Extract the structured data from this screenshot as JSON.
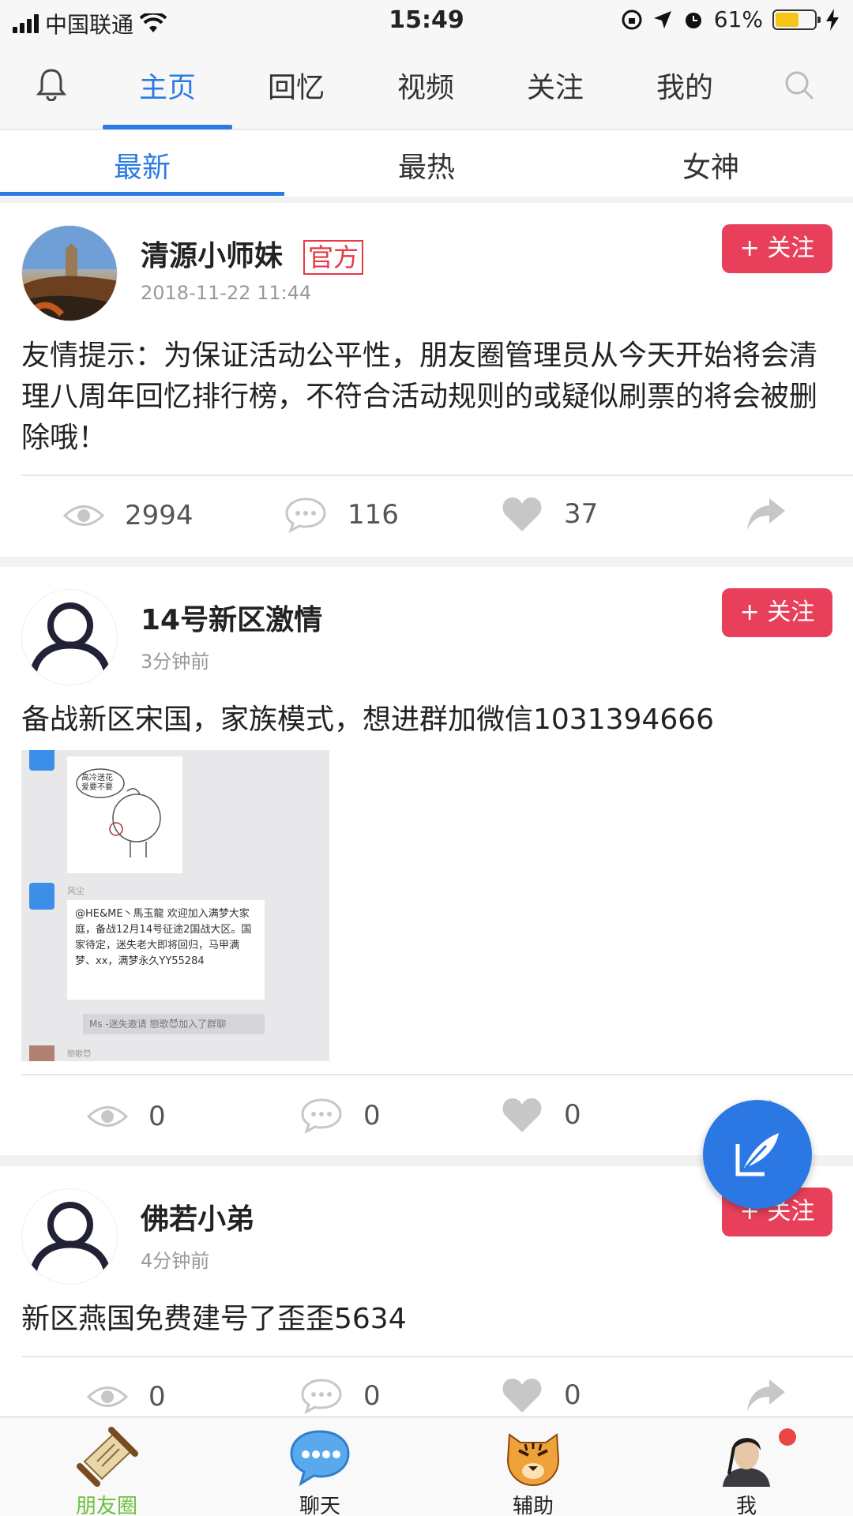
{
  "status_bar": {
    "carrier": "中国联通",
    "time": "15:49",
    "battery": "61%",
    "battery_level": 0.61
  },
  "top_nav": {
    "tabs": [
      {
        "label": "主页",
        "active": true
      },
      {
        "label": "回忆"
      },
      {
        "label": "视频"
      },
      {
        "label": "关注"
      },
      {
        "label": "我的"
      }
    ]
  },
  "sub_tabs": [
    {
      "label": "最新",
      "active": true
    },
    {
      "label": "最热"
    },
    {
      "label": "女神"
    }
  ],
  "colors": {
    "accent": "#2a7be4",
    "follow_button": "#e8405b",
    "official_badge": "#e63946",
    "bottom_active": "#6cbf3d"
  },
  "posts": [
    {
      "username": "清源小师妹",
      "badge": "官方",
      "timestamp": "2018-11-22 11:44",
      "follow_label": "+ 关注",
      "content": "友情提示：为保证活动公平性，朋友圈管理员从今天开始将会清理八周年回忆排行榜，不符合活动规则的或疑似刷票的将会被删除哦！",
      "views": "2994",
      "comments": "116",
      "likes": "37"
    },
    {
      "username": "14号新区激情",
      "timestamp": "3分钟前",
      "follow_label": "+ 关注",
      "content": "备战新区宋国，家族模式，想进群加微信1031394666",
      "image": {
        "sticker_text": "高冷送花 爱要不要",
        "sender": "风尘",
        "message": "@HE&ME丶馬玉龍  欢迎加入满梦大家庭，备战12月14号征途2国战大区。国家待定，迷失老大即将回归，马甲满梦、xx，满梦永久YY55284",
        "system_note": "Ms -迷失邀请 戀歌😈加入了群聊",
        "footer_name": "戀歌😈"
      },
      "views": "0",
      "comments": "0",
      "likes": "0"
    },
    {
      "username": "佛若小弟",
      "timestamp": "4分钟前",
      "follow_label": "+ 关注",
      "content": "新区燕国免费建号了歪歪5634",
      "views": "0",
      "comments": "0",
      "likes": "0"
    }
  ],
  "icons": {
    "bell": "bell-icon",
    "search": "search-icon",
    "views": "eye-icon",
    "comments": "comment-icon",
    "likes": "heart-icon",
    "share": "share-icon",
    "compose": "compose-icon"
  },
  "bottom_nav": [
    {
      "label": "朋友圈",
      "active": true
    },
    {
      "label": "聊天"
    },
    {
      "label": "辅助"
    },
    {
      "label": "我",
      "has_notification": true
    }
  ]
}
